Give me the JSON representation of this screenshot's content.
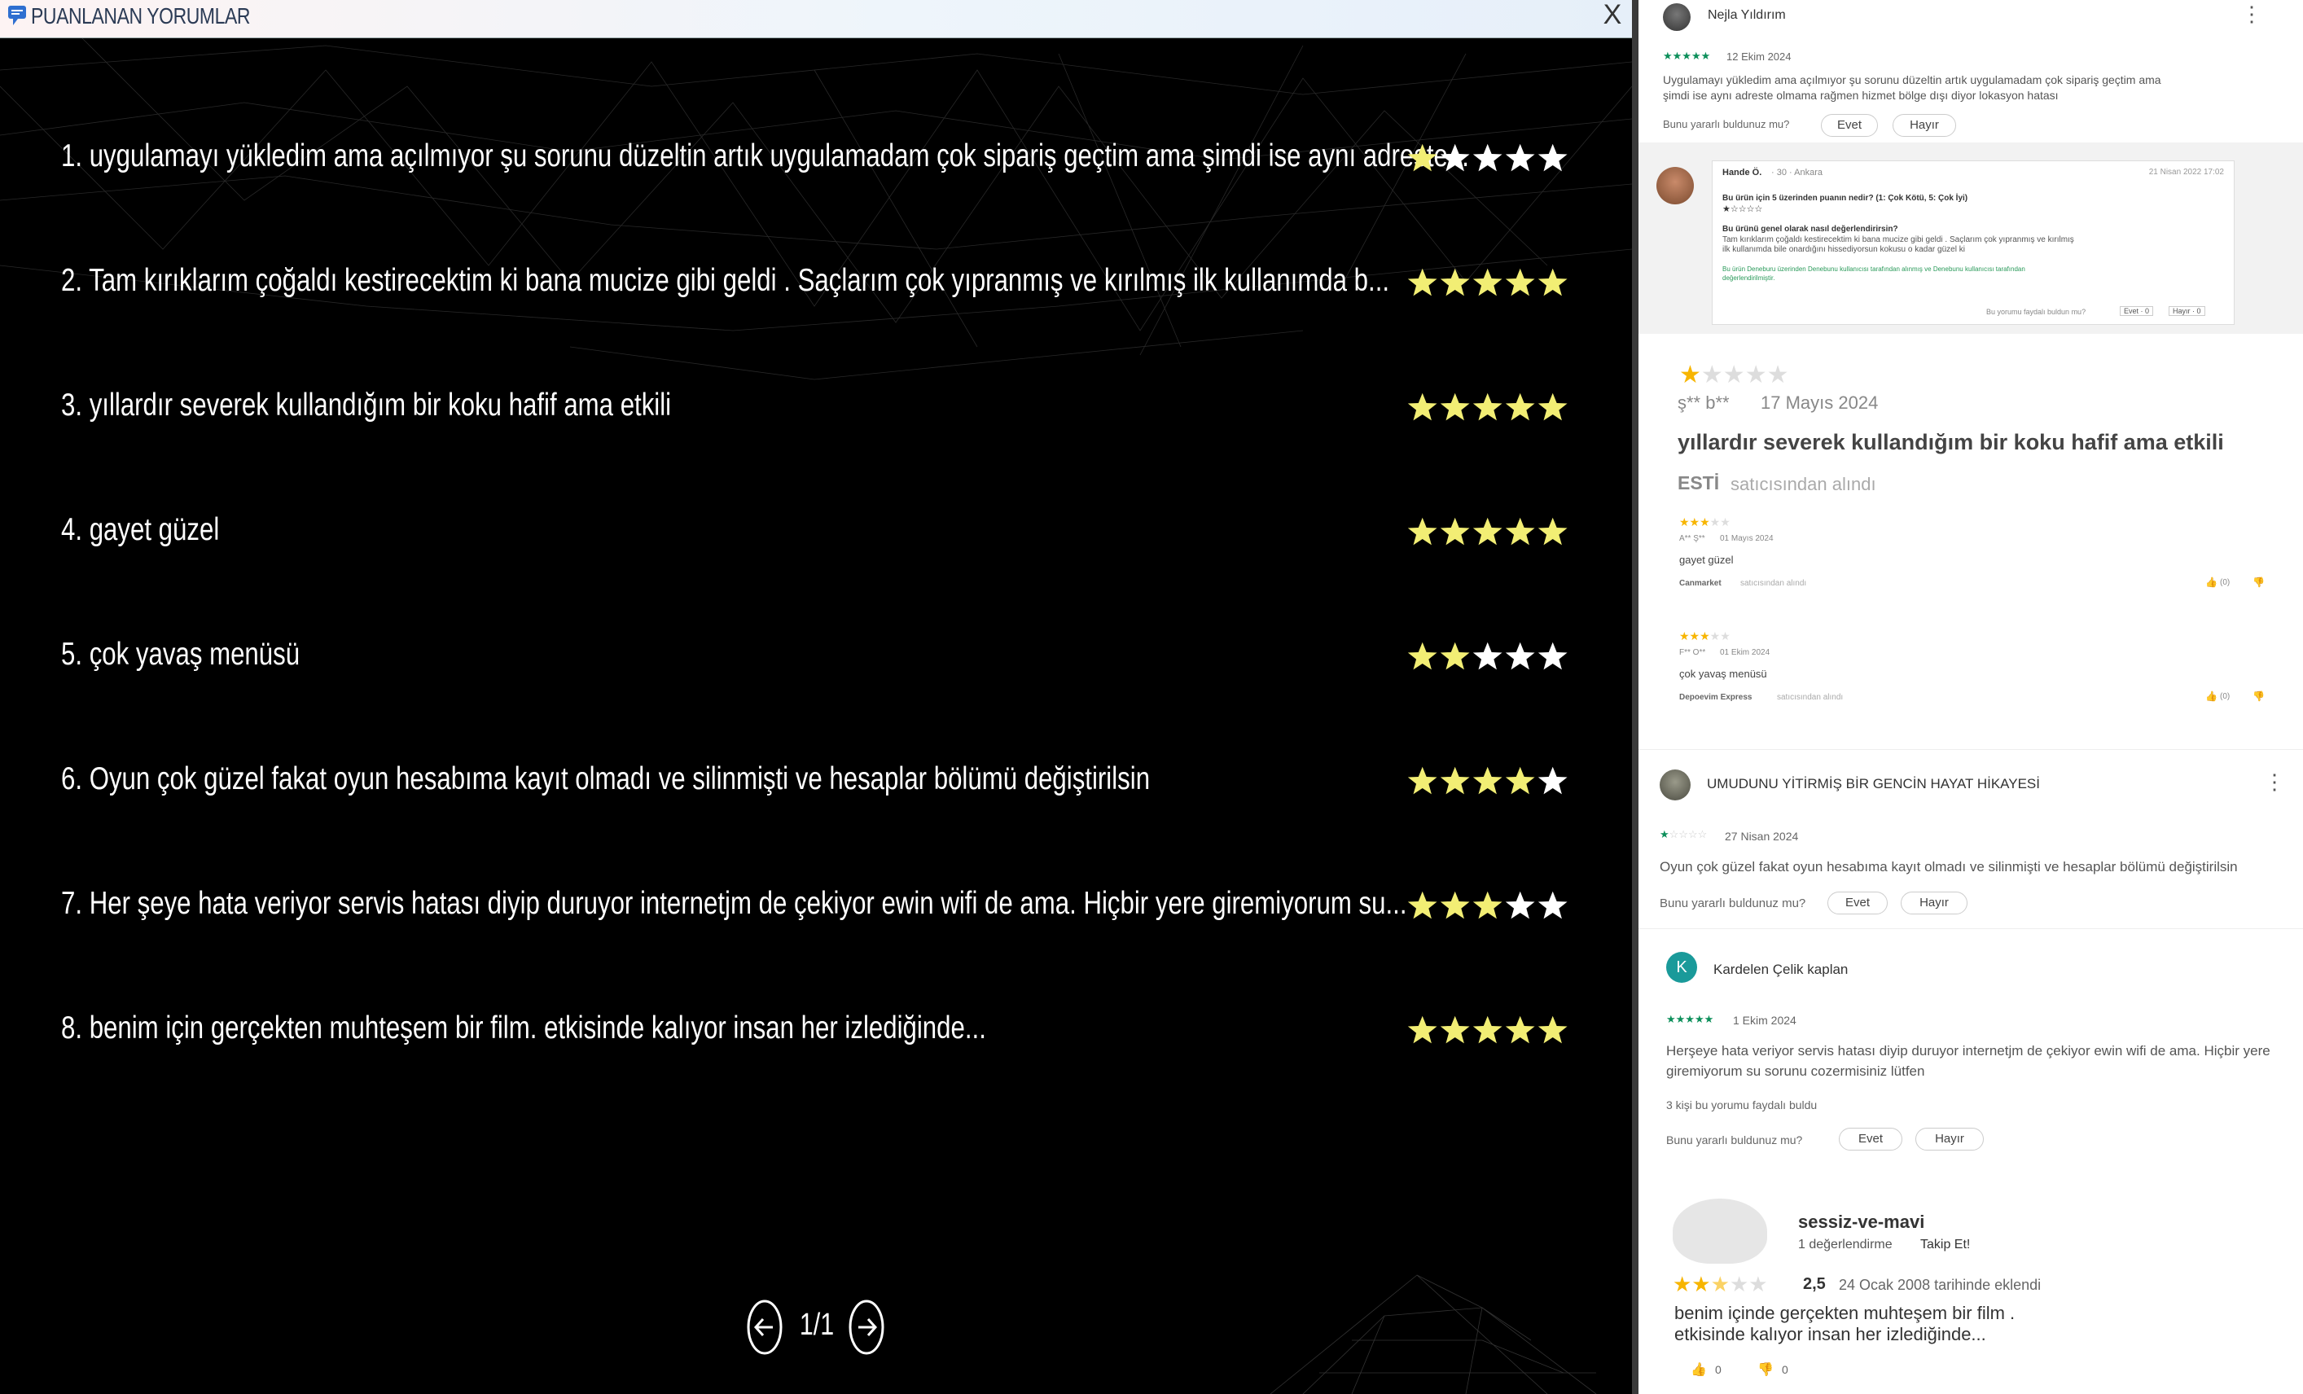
{
  "window": {
    "title": "PUANLANAN YORUMLAR",
    "close_label": "X"
  },
  "reviews": [
    {
      "text": "1. uygulamayı yükledim ama açılmıyor şu sorunu düzeltin artık uygulamadam çok sipariş geçtim ama şimdi ise aynı adreste...",
      "stars": 1
    },
    {
      "text": "2. Tam kırıklarım çoğaldı kestirecektim ki bana mucize gibi geldi . Saçlarım çok yıpranmış ve kırılmış ilk kullanımda b...",
      "stars": 5
    },
    {
      "text": "3. yıllardır severek kullandığım bir koku hafif ama etkili",
      "stars": 5
    },
    {
      "text": "4. gayet güzel",
      "stars": 5
    },
    {
      "text": "5. çok yavaş menüsü",
      "stars": 2
    },
    {
      "text": "6. Oyun çok güzel fakat oyun hesabıma kayıt olmadı ve silinmişti ve hesaplar bölümü değiştirilsin",
      "stars": 4
    },
    {
      "text": "7. Her şeye hata veriyor servis hatası diyip duruyor internetjm de çekiyor ewin wifi de ama. Hiçbir yere giremiyorum su...",
      "stars": 3
    },
    {
      "text": "8. benim için gerçekten muhteşem bir film. etkisinde kalıyor insan her izlediğinde...",
      "stars": 5
    }
  ],
  "pager": {
    "indicator": "1/1"
  },
  "colors": {
    "star_fill": "#f2ee74",
    "star_empty": "#ffffff",
    "background": "#000000"
  },
  "sources": {
    "r1": {
      "author": "Nejla Yıldırım",
      "stars": "★★★★★",
      "date": "12 Ekim 2024",
      "text_line1": "Uygulamayı yükledim ama açılmıyor şu sorunu düzeltin artık uygulamadam çok sipariş geçtim ama",
      "text_line2": "şimdi ise aynı adreste olmama rağmen hizmet bölge dışı diyor lokasyon hatası",
      "helpful_q": "Bunu yararlı buldunuz mu?",
      "yes": "Evet",
      "no": "Hayır"
    },
    "r2": {
      "author": "Hande Ö.",
      "meta": "· 30 · Ankara",
      "date": "21 Nisan 2022 17:02",
      "q1": "Bu ürün için 5 üzerinden puanın nedir? (1: Çok Kötü, 5: Çok İyi)",
      "q2": "Bu ürünü genel olarak nasıl değerlendirirsin?",
      "text_line1": "Tam kırıklarım çoğaldı kestirecektim ki bana mucize gibi geldi . Saçlarım çok yıpranmış ve kırılmış",
      "text_line2": "ilk kullanımda bile onardığını hissediyorsun kokusu o kadar güzel ki",
      "note_line1": "Bu ürün Deneburu üzerinden Denebunu kullanıcısı tarafından alınmış ve Denebunu kullanıcısı tarafından",
      "note_line2": "değerlendirilmiştir.",
      "helpful": "Bu yorumu faydalı buldun mu?",
      "yes": "Evet · 0",
      "no": "Hayır · 0"
    },
    "r3": {
      "author": "ş** b**",
      "date": "17 Mayıs 2024",
      "title": "yıllardır severek kullandığım bir koku hafif ama etkili",
      "seller": "ESTİ",
      "seller_suffix": "satıcısından alındı"
    },
    "r4": {
      "author": "A** Ş**",
      "date": "01 Mayıs 2024",
      "text": "gayet güzel",
      "seller": "Canmarket",
      "seller_suffix": "satıcısından alındı",
      "likes": "(0)"
    },
    "r5": {
      "author": "F** O**",
      "date": "01 Ekim 2024",
      "text": "çok yavaş menüsü",
      "seller": "Depoevim Express",
      "seller_suffix": "satıcısından alındı",
      "likes": "(0)"
    },
    "r6": {
      "author": "UMUDUNU YİTİRMİŞ BİR GENCİN HAYAT HİKAYESİ",
      "date": "27 Nisan 2024",
      "text": "Oyun çok güzel fakat oyun hesabıma kayıt olmadı ve silinmişti ve hesaplar bölümü değiştirilsin",
      "helpful_q": "Bunu yararlı buldunuz mu?",
      "yes": "Evet",
      "no": "Hayır"
    },
    "r7": {
      "avatar_letter": "K",
      "author": "Kardelen Çelik kaplan",
      "stars": "★★★★★",
      "date": "1 Ekim 2024",
      "text_line1": "Herşeye hata veriyor servis hatası diyip duruyor internetjm de çekiyor ewin wifi de ama. Hiçbir yere",
      "text_line2": "giremiyorum su sorunu cozermisiniz lütfen",
      "helpful_count": "3 kişi bu yorumu faydalı buldu",
      "helpful_q": "Bunu yararlı buldunuz mu?",
      "yes": "Evet",
      "no": "Hayır"
    },
    "r8": {
      "author": "sessiz-ve-mavi",
      "reviews_count": "1 değerlendirme",
      "follow": "Takip Et!",
      "rating": "2,5",
      "date": "24 Ocak 2008 tarihinde eklendi",
      "text_line1": "benim içinde gerçekten muhteşem bir film .",
      "text_line2": "etkisinde kalıyor insan her izlediğinde...",
      "likes": "0",
      "dislikes": "0"
    }
  }
}
